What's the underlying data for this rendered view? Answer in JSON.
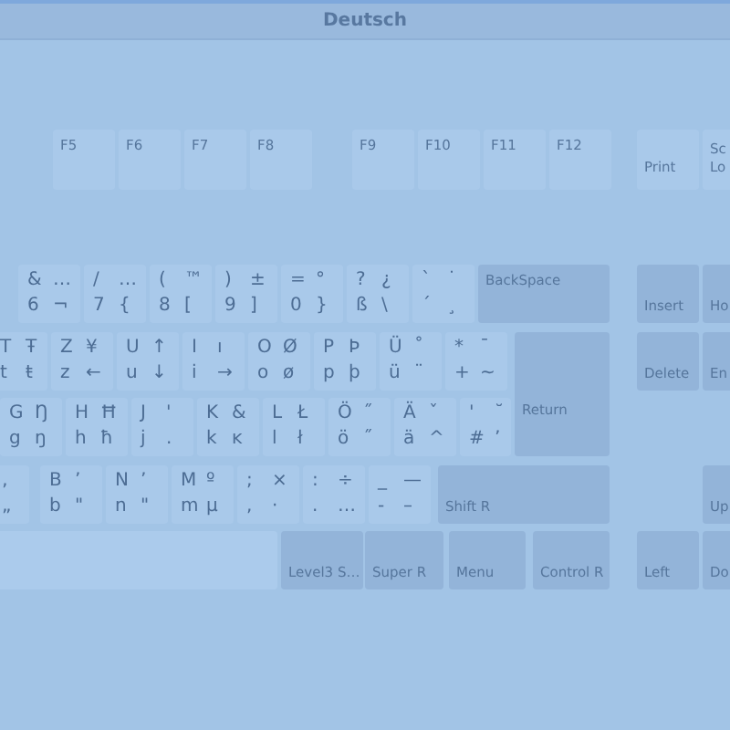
{
  "window": {
    "title": "Deutsch"
  },
  "keys": [
    {
      "kind": "function",
      "label": "F5"
    },
    {
      "kind": "function",
      "label": "F6"
    },
    {
      "kind": "function",
      "label": "F7"
    },
    {
      "kind": "function",
      "label": "F8"
    },
    {
      "kind": "function",
      "label": "F9"
    },
    {
      "kind": "function",
      "label": "F10"
    },
    {
      "kind": "function",
      "label": "F11"
    },
    {
      "kind": "function",
      "label": "F12"
    },
    {
      "kind": "lower",
      "label": "Print"
    },
    {
      "kind": "lower",
      "label": "Sc Lo"
    },
    {
      "kind": "char",
      "legends": [
        "&",
        "…",
        "6",
        "¬"
      ]
    },
    {
      "kind": "char",
      "legends": [
        "/",
        "…",
        "7",
        "{"
      ]
    },
    {
      "kind": "char",
      "legends": [
        "(",
        "™",
        "8",
        "["
      ]
    },
    {
      "kind": "char",
      "legends": [
        ")",
        "±",
        "9",
        "]"
      ]
    },
    {
      "kind": "char",
      "legends": [
        "=",
        "°",
        "0",
        "}"
      ]
    },
    {
      "kind": "char",
      "legends": [
        "?",
        "¿",
        "ß",
        "\\"
      ]
    },
    {
      "kind": "char",
      "legends": [
        "`",
        "˙",
        "´",
        "¸"
      ]
    },
    {
      "kind": "modifier",
      "label": "BackSpace"
    },
    {
      "kind": "modifier",
      "label": "Insert"
    },
    {
      "kind": "modifier",
      "label": "Ho"
    },
    {
      "kind": "char",
      "legends": [
        "T",
        "Ŧ",
        "t",
        "ŧ"
      ]
    },
    {
      "kind": "char",
      "legends": [
        "Z",
        "¥",
        "z",
        "←"
      ]
    },
    {
      "kind": "char",
      "legends": [
        "U",
        "↑",
        "u",
        "↓"
      ]
    },
    {
      "kind": "char",
      "legends": [
        "I",
        "ı",
        "i",
        "→"
      ]
    },
    {
      "kind": "char",
      "legends": [
        "O",
        "Ø",
        "o",
        "ø"
      ]
    },
    {
      "kind": "char",
      "legends": [
        "P",
        "Þ",
        "p",
        "þ"
      ]
    },
    {
      "kind": "char",
      "legends": [
        "Ü",
        "˚",
        "ü",
        "¨"
      ]
    },
    {
      "kind": "char",
      "legends": [
        "*",
        "¯",
        "+",
        "~"
      ]
    },
    {
      "kind": "modifier",
      "label": "Return"
    },
    {
      "kind": "modifier",
      "label": "Delete"
    },
    {
      "kind": "modifier",
      "label": "En"
    },
    {
      "kind": "char",
      "legends": [
        "G",
        "Ŋ",
        "g",
        "ŋ"
      ]
    },
    {
      "kind": "char",
      "legends": [
        "H",
        "Ħ",
        "h",
        "ħ"
      ]
    },
    {
      "kind": "char",
      "legends": [
        "J",
        "'",
        "j",
        "."
      ]
    },
    {
      "kind": "char",
      "legends": [
        "K",
        "&",
        "k",
        "ĸ"
      ]
    },
    {
      "kind": "char",
      "legends": [
        "L",
        "Ł",
        "l",
        "ł"
      ]
    },
    {
      "kind": "char",
      "legends": [
        "Ö",
        "˝",
        "ö",
        "˝"
      ]
    },
    {
      "kind": "char",
      "legends": [
        "Ä",
        "ˇ",
        "ä",
        "^"
      ]
    },
    {
      "kind": "char",
      "legends": [
        "'",
        "˘",
        "#",
        "’"
      ]
    },
    {
      "kind": "char",
      "legends": [
        "‚",
        "„"
      ]
    },
    {
      "kind": "char",
      "legends": [
        "B",
        "ʼ",
        "b",
        "\""
      ]
    },
    {
      "kind": "char",
      "legends": [
        "N",
        "ʼ",
        "n",
        "\""
      ]
    },
    {
      "kind": "char",
      "legends": [
        "M",
        "º",
        "m",
        "µ"
      ]
    },
    {
      "kind": "char",
      "legends": [
        ";",
        "×",
        ",",
        "·"
      ]
    },
    {
      "kind": "char",
      "legends": [
        ":",
        "÷",
        ".",
        "…"
      ]
    },
    {
      "kind": "char",
      "legends": [
        "_",
        "—",
        "-",
        "–"
      ]
    },
    {
      "kind": "modifier",
      "label": "Shift R"
    },
    {
      "kind": "modifier",
      "label": "Up"
    },
    {
      "kind": "space"
    },
    {
      "kind": "modifier",
      "label": "Level3 S…"
    },
    {
      "kind": "modifier",
      "label": "Super R"
    },
    {
      "kind": "modifier",
      "label": "Menu"
    },
    {
      "kind": "modifier",
      "label": "Control R"
    },
    {
      "kind": "modifier",
      "label": "Left"
    },
    {
      "kind": "modifier",
      "label": "Do"
    }
  ]
}
